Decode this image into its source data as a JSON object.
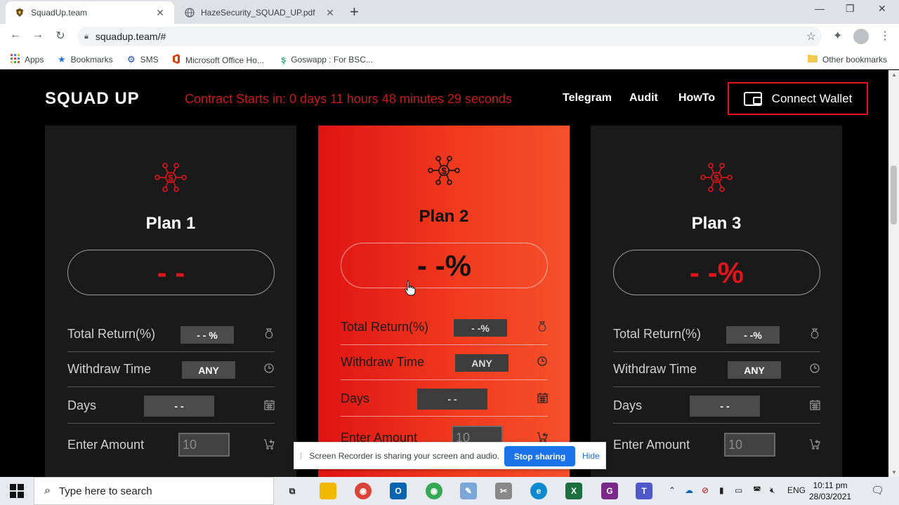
{
  "browser": {
    "tabs": [
      {
        "title": "SquadUp.team",
        "active": true
      },
      {
        "title": "HazeSecurity_SQUAD_UP.pdf",
        "active": false
      }
    ],
    "url": "squadup.team/#",
    "bookmarks": [
      {
        "label": "Apps",
        "icon": "apps-grid-icon"
      },
      {
        "label": "Bookmarks",
        "icon": "star-icon"
      },
      {
        "label": "SMS",
        "icon": "sms-icon"
      },
      {
        "label": "Microsoft Office Ho...",
        "icon": "office-icon"
      },
      {
        "label": "Goswapp : For BSC...",
        "icon": "goswapp-icon"
      }
    ],
    "other_bookmarks": "Other bookmarks"
  },
  "site": {
    "logo": "SQUAD UP",
    "countdown": "Contract Starts in: 0 days 11 hours 48 minutes 29 seconds",
    "nav": [
      "Telegram",
      "Audit",
      "HowTo"
    ],
    "connect_label": "Connect Wallet",
    "accent": "#e0141a"
  },
  "plans": [
    {
      "title": "Plan 1",
      "rate": "- -",
      "total_return_label": "Total Return(%)",
      "total_return": "- - %",
      "withdraw_label": "Withdraw Time",
      "withdraw": "ANY",
      "days_label": "Days",
      "days": "- -",
      "amount_label": "Enter Amount",
      "amount_placeholder": "10"
    },
    {
      "title": "Plan 2",
      "rate": "- -%",
      "total_return_label": "Total Return(%)",
      "total_return": "- -%",
      "withdraw_label": "Withdraw Time",
      "withdraw": "ANY",
      "days_label": "Days",
      "days": "- -",
      "amount_label": "Enter Amount",
      "amount_placeholder": "10"
    },
    {
      "title": "Plan 3",
      "rate": "- -%",
      "total_return_label": "Total Return(%)",
      "total_return": "- -%",
      "withdraw_label": "Withdraw Time",
      "withdraw": "ANY",
      "days_label": "Days",
      "days": "- -",
      "amount_label": "Enter Amount",
      "amount_placeholder": "10"
    }
  ],
  "share_bar": {
    "message": "Screen Recorder is sharing your screen and audio.",
    "stop_label": "Stop sharing",
    "hide_label": "Hide"
  },
  "taskbar": {
    "search_placeholder": "Type here to search",
    "language": "ENG",
    "time": "10:11 pm",
    "date": "28/03/2021"
  }
}
